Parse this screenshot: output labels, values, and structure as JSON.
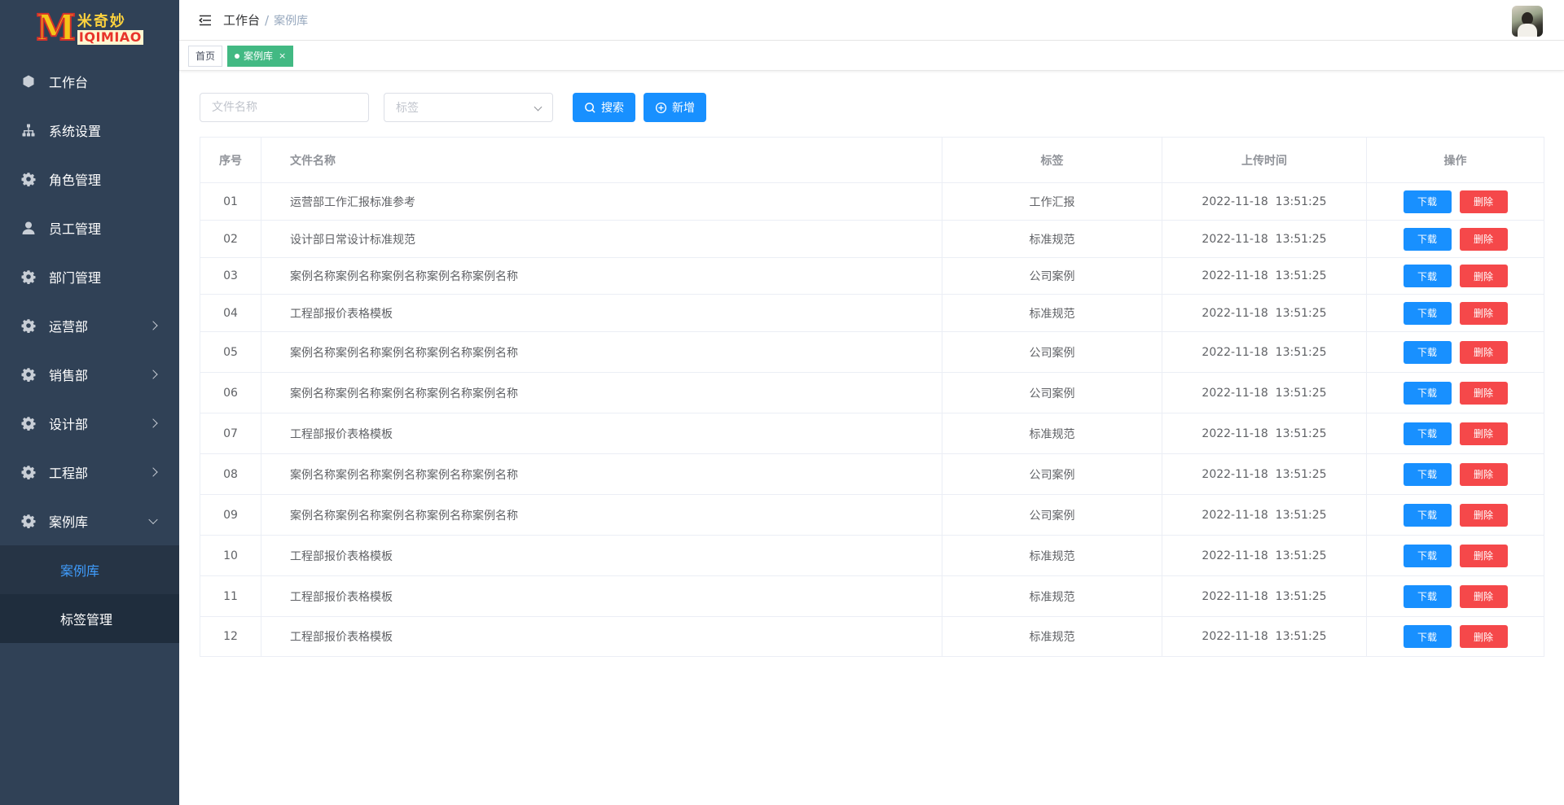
{
  "logo": {
    "cn": "米奇妙",
    "en": "IQIMIAO",
    "mark": "M"
  },
  "sidebar": {
    "items": [
      {
        "label": "工作台",
        "icon": "cube-icon",
        "arrow": false
      },
      {
        "label": "系统设置",
        "icon": "sitemap-icon",
        "arrow": false
      },
      {
        "label": "角色管理",
        "icon": "gear-icon",
        "arrow": false
      },
      {
        "label": "员工管理",
        "icon": "user-icon",
        "arrow": false
      },
      {
        "label": "部门管理",
        "icon": "gear-icon",
        "arrow": false
      },
      {
        "label": "运营部",
        "icon": "gear-icon",
        "arrow": true
      },
      {
        "label": "销售部",
        "icon": "gear-icon",
        "arrow": true
      },
      {
        "label": "设计部",
        "icon": "gear-icon",
        "arrow": true
      },
      {
        "label": "工程部",
        "icon": "gear-icon",
        "arrow": true
      },
      {
        "label": "案例库",
        "icon": "gear-icon",
        "arrow": true,
        "open": true
      }
    ],
    "sub_items": [
      {
        "label": "案例库",
        "active": true
      },
      {
        "label": "标签管理",
        "active": false
      }
    ]
  },
  "header": {
    "breadcrumb": [
      "工作台",
      "案例库"
    ],
    "separator": "/"
  },
  "tagsview": {
    "tags": [
      {
        "label": "首页",
        "active": false
      },
      {
        "label": "案例库",
        "active": true,
        "close": "×"
      }
    ]
  },
  "filters": {
    "name_placeholder": "文件名称",
    "tag_placeholder": "标签",
    "search_label": "搜索",
    "add_label": "新增"
  },
  "table": {
    "headers": [
      "序号",
      "文件名称",
      "标签",
      "上传时间",
      "操作"
    ],
    "download_label": "下载",
    "delete_label": "删除",
    "rows": [
      {
        "idx": "01",
        "name": "运营部工作汇报标准参考",
        "tag": "工作汇报",
        "time": "2022-11-18  13:51:25"
      },
      {
        "idx": "02",
        "name": "设计部日常设计标准规范",
        "tag": "标准规范",
        "time": "2022-11-18  13:51:25"
      },
      {
        "idx": "03",
        "name": "案例名称案例名称案例名称案例名称案例名称",
        "tag": "公司案例",
        "time": "2022-11-18  13:51:25"
      },
      {
        "idx": "04",
        "name": "工程部报价表格模板",
        "tag": "标准规范",
        "time": "2022-11-18  13:51:25"
      },
      {
        "idx": "05",
        "name": "案例名称案例名称案例名称案例名称案例名称",
        "tag": "公司案例",
        "time": "2022-11-18  13:51:25"
      },
      {
        "idx": "06",
        "name": "案例名称案例名称案例名称案例名称案例名称",
        "tag": "公司案例",
        "time": "2022-11-18  13:51:25"
      },
      {
        "idx": "07",
        "name": "工程部报价表格模板",
        "tag": "标准规范",
        "time": "2022-11-18  13:51:25"
      },
      {
        "idx": "08",
        "name": "案例名称案例名称案例名称案例名称案例名称",
        "tag": "公司案例",
        "time": "2022-11-18  13:51:25"
      },
      {
        "idx": "09",
        "name": "案例名称案例名称案例名称案例名称案例名称",
        "tag": "公司案例",
        "time": "2022-11-18  13:51:25"
      },
      {
        "idx": "10",
        "name": "工程部报价表格模板",
        "tag": "标准规范",
        "time": "2022-11-18  13:51:25"
      },
      {
        "idx": "11",
        "name": "工程部报价表格模板",
        "tag": "标准规范",
        "time": "2022-11-18  13:51:25"
      },
      {
        "idx": "12",
        "name": "工程部报价表格模板",
        "tag": "标准规范",
        "time": "2022-11-18  13:51:25"
      }
    ]
  },
  "colors": {
    "sidebar_bg": "#304156",
    "submenu_bg": "#1f2d3d",
    "active_text": "#409eff",
    "primary": "#1890ff",
    "danger": "#f5484a",
    "tag_active": "#42b983"
  }
}
